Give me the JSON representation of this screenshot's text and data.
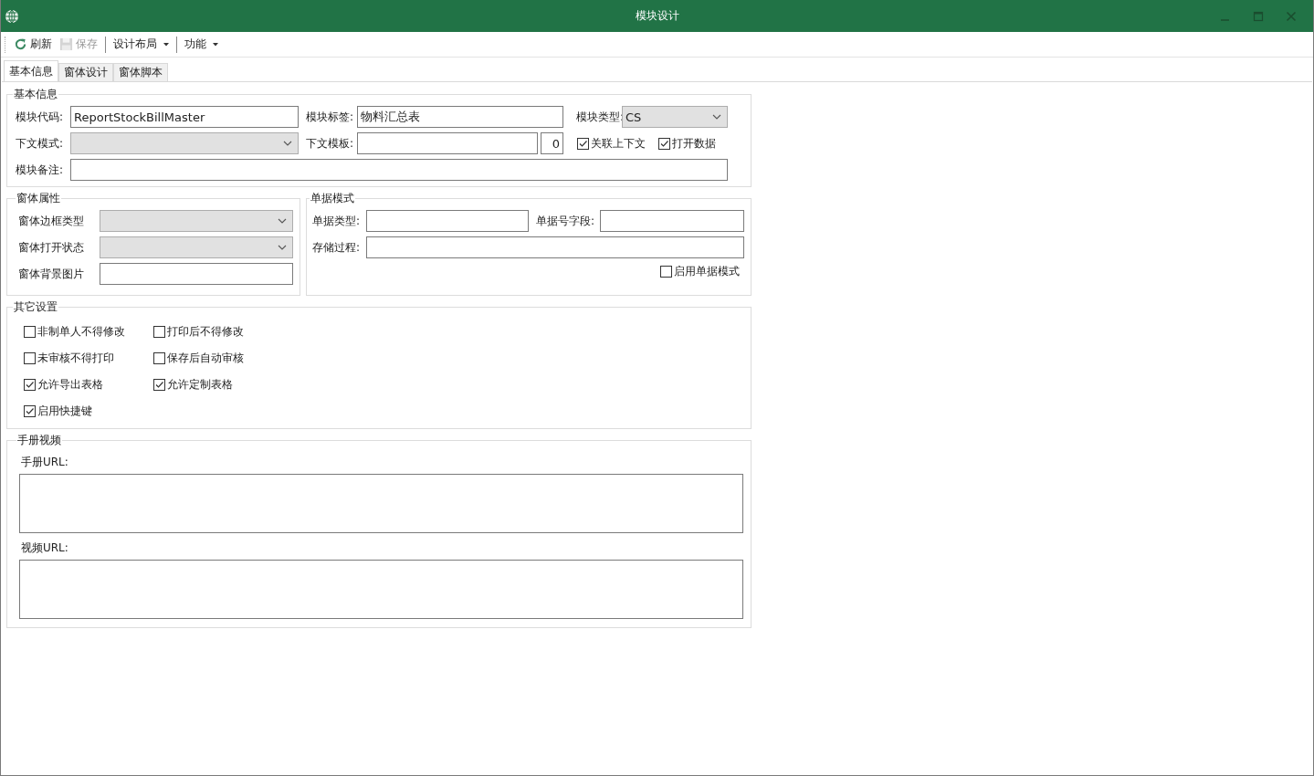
{
  "window": {
    "title": "模块设计"
  },
  "toolbar": [
    {
      "label": "刷新",
      "kind": "refresh",
      "disabled": false
    },
    {
      "label": "保存",
      "kind": "save",
      "disabled": true
    },
    {
      "label": "设计布局",
      "kind": "dropdown",
      "disabled": false
    },
    {
      "label": "功能",
      "kind": "dropdown",
      "disabled": false
    }
  ],
  "tabs": [
    {
      "label": "基本信息",
      "selected": true
    },
    {
      "label": "窗体设计",
      "selected": false
    },
    {
      "label": "窗体脚本",
      "selected": false
    }
  ],
  "basic_info": {
    "title": "基本信息",
    "module_code": {
      "label": "模块代码:",
      "value": "ReportStockBillMaster"
    },
    "module_label": {
      "label": "模块标签:",
      "value": "物料汇总表"
    },
    "module_type": {
      "label": "模块类型:",
      "value": "CS"
    },
    "context_mode": {
      "label": "下文模式:"
    },
    "context_template": {
      "label": "下文模板:",
      "number": "0"
    },
    "link_context": {
      "label": "关联上下文",
      "checked": true
    },
    "open_data": {
      "label": "打开数据",
      "checked": true
    },
    "remark": {
      "label": "模块备注:"
    }
  },
  "form_props": {
    "title": "窗体属性",
    "fields": [
      {
        "label": "窗体边框类型",
        "kind": "dropdown"
      },
      {
        "label": "窗体打开状态",
        "kind": "dropdown"
      },
      {
        "label": "窗体背景图片",
        "kind": "text"
      }
    ]
  },
  "bill_mode": {
    "title": "单据模式",
    "bill_type": {
      "label": "单据类型:"
    },
    "bill_no_field": {
      "label": "单据号字段:"
    },
    "procedure": {
      "label": "存储过程:"
    },
    "enable": {
      "label": "启用单据模式",
      "checked": false
    }
  },
  "other_settings": {
    "title": "其它设置",
    "options": [
      {
        "label": "非制单人不得修改",
        "checked": false
      },
      {
        "label": "打印后不得修改",
        "checked": false
      },
      {
        "label": "未审核不得打印",
        "checked": false
      },
      {
        "label": "保存后自动审核",
        "checked": false
      },
      {
        "label": "允许导出表格",
        "checked": true
      },
      {
        "label": "允许定制表格",
        "checked": true
      },
      {
        "label": "启用快捷键",
        "checked": true
      }
    ]
  },
  "manual_video": {
    "title": "手册视频",
    "manual_url": {
      "label": "手册URL:"
    },
    "video_url": {
      "label": "视频URL:"
    }
  }
}
